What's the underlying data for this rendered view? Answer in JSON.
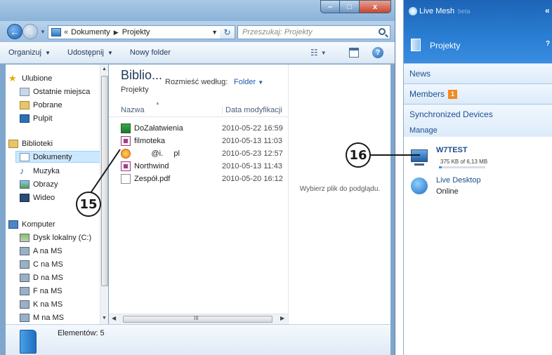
{
  "explorer": {
    "window_buttons": {
      "minimize": "–",
      "maximize": "□",
      "close": "x"
    },
    "address": {
      "chevron": "«",
      "crumbs": [
        "Dokumenty",
        "Projekty"
      ]
    },
    "search_placeholder": "Przeszukaj: Projekty",
    "toolbar": {
      "organize": "Organizuj",
      "share": "Udostępnij",
      "new_folder": "Nowy folder"
    },
    "nav": {
      "favorites": "Ulubione",
      "recent": "Ostatnie miejsca",
      "downloads": "Pobrane",
      "desktop": "Pulpit",
      "libraries": "Biblioteki",
      "documents": "Dokumenty",
      "music": "Muzyka",
      "pictures": "Obrazy",
      "video": "Wideo",
      "computer": "Komputer",
      "drives": [
        "Dysk lokalny (C:)",
        "A na MS",
        "C na MS",
        "D na MS",
        "F na MS",
        "K na MS",
        "M na MS"
      ]
    },
    "library": {
      "title": "Biblio...",
      "subtitle": "Projekty",
      "arrange_label": "Rozmieść według:",
      "arrange_value": "Folder"
    },
    "columns": {
      "name": "Nazwa",
      "date": "Data modyfikacji"
    },
    "files": [
      {
        "name": "DoZałatwienia",
        "date": "2010-05-22 16:59",
        "icon": "excel-icon"
      },
      {
        "name": "filmoteka",
        "date": "2010-05-13 11:03",
        "icon": "access-icon"
      },
      {
        "name": "        @i.     pl",
        "date": "2010-05-23 12:57",
        "icon": "mail-icon"
      },
      {
        "name": "Northwind",
        "date": "2010-05-13 11:43",
        "icon": "access-icon"
      },
      {
        "name": "Zespół.pdf",
        "date": "2010-05-20 16:12",
        "icon": "pdf-icon"
      }
    ],
    "preview_hint": "Wybierz plik do podglądu.",
    "hscroll_mark": "III",
    "status": "Elementów: 5"
  },
  "callouts": {
    "left": "15",
    "right": "16"
  },
  "mesh": {
    "title": "Live Mesh",
    "beta": "beta",
    "folder": "Projekty",
    "sections": {
      "news": "News",
      "members": "Members",
      "members_badge": "1",
      "devices": "Synchronized Devices"
    },
    "manage": "Manage",
    "devices": [
      {
        "name": "W7TEST",
        "usage": "375 KB of 6,13 MB",
        "usage_fraction": 0.06
      },
      {
        "name": "Live Desktop",
        "status": "Online"
      }
    ]
  },
  "colors": {
    "accent": "#2a7fd4",
    "selection": "#cce8ff",
    "badge": "#f28a20"
  }
}
